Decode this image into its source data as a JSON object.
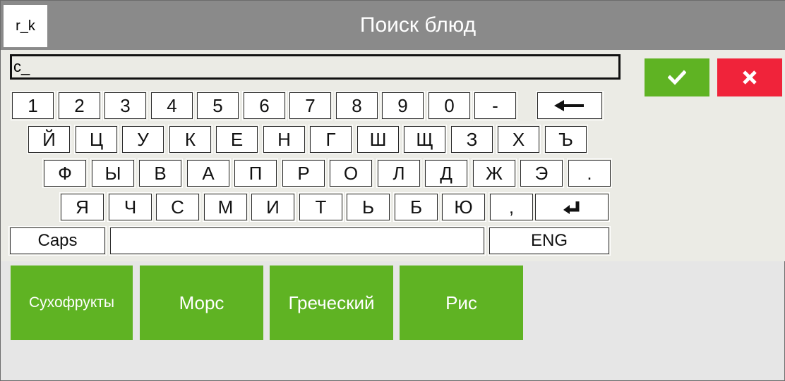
{
  "header": {
    "app_tag": "r_k",
    "title": "Поиск блюд"
  },
  "search": {
    "value": "с_"
  },
  "actions": {
    "ok_icon": "check-icon",
    "cancel_icon": "close-icon",
    "ok_color": "#5fb323",
    "cancel_color": "#f0233a"
  },
  "keyboard": {
    "row1": [
      "1",
      "2",
      "3",
      "4",
      "5",
      "6",
      "7",
      "8",
      "9",
      "0",
      "-"
    ],
    "row2": [
      "Й",
      "Ц",
      "У",
      "К",
      "Е",
      "Н",
      "Г",
      "Ш",
      "Щ",
      "З",
      "Х",
      "Ъ"
    ],
    "row3": [
      "Ф",
      "Ы",
      "В",
      "А",
      "П",
      "Р",
      "О",
      "Л",
      "Д",
      "Ж",
      "Э",
      "."
    ],
    "row4": [
      "Я",
      "Ч",
      "С",
      "М",
      "И",
      "Т",
      "Ь",
      "Б",
      "Ю",
      ","
    ],
    "caps_label": "Caps",
    "lang_label": "ENG",
    "backspace_icon": "arrow-left-icon",
    "enter_icon": "enter-icon"
  },
  "results": [
    {
      "label": "Сухофрукты"
    },
    {
      "label": "Морс"
    },
    {
      "label": "Греческий"
    },
    {
      "label": "Рис"
    }
  ]
}
